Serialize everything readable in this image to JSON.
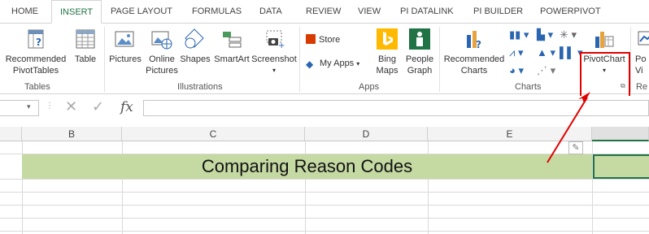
{
  "tabs": [
    "HOME",
    "INSERT",
    "PAGE LAYOUT",
    "FORMULAS",
    "DATA",
    "REVIEW",
    "VIEW",
    "PI DATALINK",
    "PI BUILDER",
    "POWERPIVOT"
  ],
  "ribbon": {
    "tables": {
      "recommended_label": "Recommended\nPivotTables",
      "table_label": "Table",
      "group_label": "Tables"
    },
    "illustrations": {
      "pictures": "Pictures",
      "online_pictures": "Online\nPictures",
      "shapes": "Shapes",
      "smartart": "SmartArt",
      "screenshot": "Screenshot",
      "group_label": "Illustrations"
    },
    "apps": {
      "store": "Store",
      "my_apps": "My Apps",
      "bing_maps": "Bing\nMaps",
      "people_graph": "People\nGraph",
      "group_label": "Apps"
    },
    "charts": {
      "recommended": "Recommended\nCharts",
      "pivotchart": "PivotChart",
      "group_label": "Charts"
    },
    "power": {
      "label": "Po\nVi",
      "group_label": "Re"
    }
  },
  "formula_bar": {
    "fx": "fx"
  },
  "grid": {
    "columns": [
      "B",
      "C",
      "D",
      "E"
    ],
    "title": "Comparing Reason Codes"
  },
  "colors": {
    "accent": "#217346",
    "title_fill": "#c5d9a3",
    "highlight": "#e00000",
    "bing": "#ffb900",
    "people": "#217346",
    "store": "#d83b01"
  }
}
